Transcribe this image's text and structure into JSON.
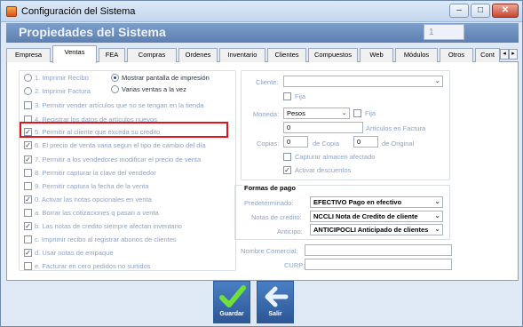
{
  "window": {
    "title": "Configuración del Sistema",
    "minimize": "–",
    "restore": "□",
    "close": "✕"
  },
  "header": {
    "title": "Propiedades del Sistema",
    "field_value": "1"
  },
  "tabs": [
    "Empresa",
    "Ventas",
    "FEA",
    "Compras",
    "Ordenes",
    "Inventario",
    "Clientes",
    "Compuestos",
    "Web",
    "Módulos",
    "Otros",
    "Cont"
  ],
  "active_tab": "Ventas",
  "options": {
    "radio_left": [
      {
        "label": "1. Imprimir Recibo",
        "selected": false
      },
      {
        "label": "2. Imprimir Factura",
        "selected": false
      }
    ],
    "radio_right": [
      {
        "label": "Mostrar pantalla de impresión",
        "selected": true
      },
      {
        "label": "Varias ventas a la vez",
        "selected": false
      }
    ],
    "checks": [
      {
        "label": "3. Permitir vender artículos que no se tengan en la tienda",
        "checked": false
      },
      {
        "label": "4. Registrar los datos de artículos nuevos",
        "checked": false
      },
      {
        "label": "5. Permitir al cliente que exceda su credito",
        "checked": true
      },
      {
        "label": "6. El precio de venta varia segun el tipo de cambio del día",
        "checked": true
      },
      {
        "label": "7. Permitir a los vendedores modificar el precio de venta",
        "checked": true
      },
      {
        "label": "8. Permitir capturar la clave del vendedor",
        "checked": false
      },
      {
        "label": "9. Permitir captura la fecha de la venta",
        "checked": false
      },
      {
        "label": "0. Activar las notas opcionales en venta",
        "checked": true
      },
      {
        "label": "a. Borrar las cotizaciones q pasan a venta",
        "checked": false
      },
      {
        "label": "b. Las notas de credito siempre afectan inventario",
        "checked": true
      },
      {
        "label": "c. Imprimir recibo al registrar abonos de clientes",
        "checked": false
      },
      {
        "label": "d. Usar notas de empaque",
        "checked": true
      },
      {
        "label": "e. Facturar en cero pedidos no surtidos",
        "checked": false
      }
    ]
  },
  "right": {
    "cliente_label": "Cliente:",
    "cliente_value": "",
    "fija1": "Fija",
    "moneda_label": "Moneda:",
    "moneda_value": "Pesos",
    "fija2": "Fija",
    "articulos_value": "0",
    "articulos_label": "Artículos en Factura",
    "copias_label": "Copias:",
    "copias_value": "0",
    "de_copia": "de Copia",
    "original_value": "0",
    "de_original": "de Original",
    "capturar_almacen": "Capturar almacen afectado",
    "activar_descuentos": "Activar descuentos"
  },
  "formas_pago": {
    "title": "Formas de pago",
    "predeterminado_label": "Predeterminado:",
    "predeterminado_value": "EFECTIVO Pago en efectivo",
    "notas_label": "Notas de credito:",
    "notas_value": "NCCLI Nota de Credito de cliente",
    "anticipo_label": "Anticipo:",
    "anticipo_value": "ANTICIPOCLI Anticipado de clientes"
  },
  "extra": {
    "nombre_comercial": "Nombre Comercial:",
    "curp": "CURP:"
  },
  "buttons": {
    "guardar": "Guardar",
    "salir": "Salir"
  }
}
